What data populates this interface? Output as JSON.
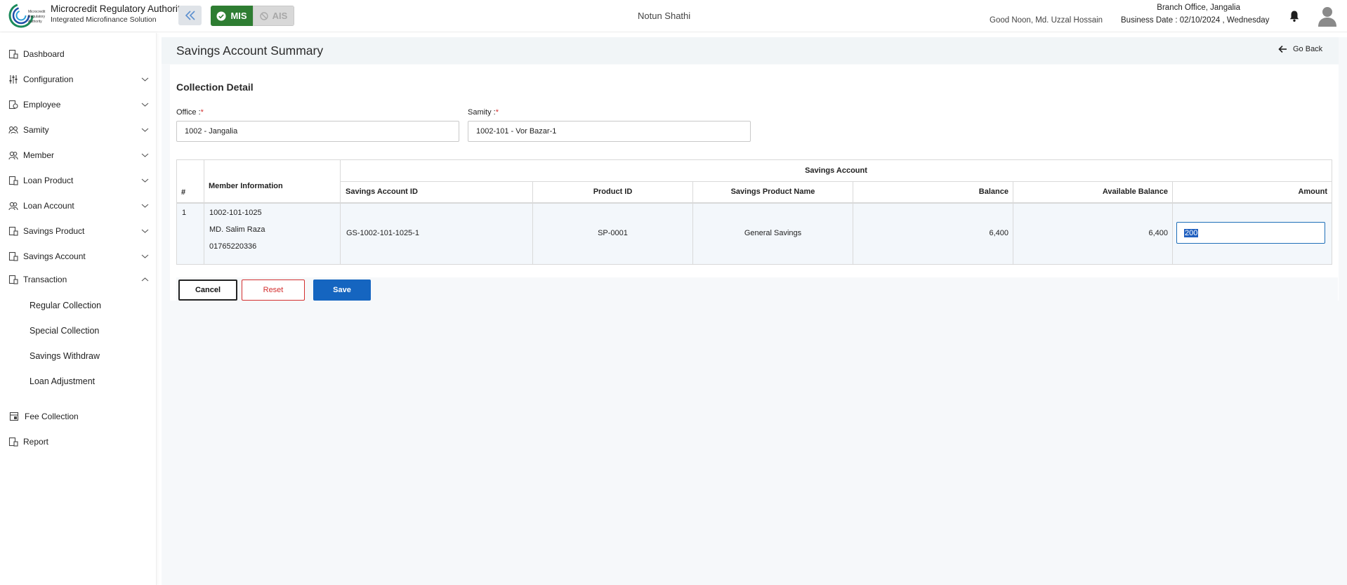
{
  "header": {
    "org_name": "Microcredit Regulatory Authority",
    "org_sub": "Integrated Microfinance Solution",
    "logo_text": "Microcredit Regulatory Authority",
    "mode_active": "MIS",
    "mode_inactive": "AIS",
    "app_name": "Notun Shathi",
    "greeting": "Good Noon, Md. Uzzal Hossain",
    "branch": "Branch Office, Jangalia",
    "business_date": "Business Date : 02/10/2024 , Wednesday",
    "accent_green": "#2e7d32",
    "icons": [
      "collapse-icon",
      "check-circle-icon",
      "block-icon",
      "bell-icon",
      "user-avatar-icon"
    ]
  },
  "sidebar": {
    "items": [
      {
        "label": "Dashboard",
        "icon": "dashboard-icon",
        "chevron": "none"
      },
      {
        "label": "Configuration",
        "icon": "configuration-icon",
        "chevron": "down"
      },
      {
        "label": "Employee",
        "icon": "employee-icon",
        "chevron": "down"
      },
      {
        "label": "Samity",
        "icon": "samity-icon",
        "chevron": "down"
      },
      {
        "label": "Member",
        "icon": "member-icon",
        "chevron": "down"
      },
      {
        "label": "Loan Product",
        "icon": "loan-product-icon",
        "chevron": "down"
      },
      {
        "label": "Loan Account",
        "icon": "loan-account-icon",
        "chevron": "down"
      },
      {
        "label": "Savings Product",
        "icon": "savings-product-icon",
        "chevron": "down"
      },
      {
        "label": "Savings Account",
        "icon": "savings-account-icon",
        "chevron": "down"
      },
      {
        "label": "Transaction",
        "icon": "transaction-icon",
        "chevron": "up"
      }
    ],
    "transaction_sub": [
      {
        "label": "Regular Collection"
      },
      {
        "label": "Special Collection"
      },
      {
        "label": "Savings Withdraw"
      },
      {
        "label": "Loan Adjustment"
      }
    ],
    "bottom_items": [
      {
        "label": "Fee Collection",
        "icon": "fee-collection-icon"
      },
      {
        "label": "Report",
        "icon": "report-icon"
      }
    ]
  },
  "page": {
    "title": "Savings Account Summary",
    "go_back": "Go Back",
    "section_title": "Collection Detail",
    "office": {
      "label": "Office :",
      "required": "*",
      "value": "1002 - Jangalia"
    },
    "samity": {
      "label": "Samity :",
      "required": "*",
      "value": "1002-101 - Vor Bazar-1"
    }
  },
  "table": {
    "group_header": "Savings Account",
    "columns": {
      "index": "#",
      "member_info": "Member Information",
      "savings_account_id": "Savings Account ID",
      "product_id": "Product ID",
      "savings_product_name": "Savings Product Name",
      "balance": "Balance",
      "available_balance": "Available Balance",
      "amount": "Amount"
    },
    "rows": [
      {
        "index": "1",
        "member_code": "1002-101-1025",
        "member_name": "MD. Salim Raza",
        "member_phone": "01765220336",
        "savings_account_id": "GS-1002-101-1025-1",
        "product_id": "SP-0001",
        "savings_product_name": "General Savings",
        "balance": "6,400",
        "available_balance": "6,400",
        "amount": "200"
      }
    ]
  },
  "actions": {
    "cancel": "Cancel",
    "reset": "Reset",
    "save": "Save",
    "save_color": "#1565c0",
    "reset_color": "#d32f2f"
  }
}
